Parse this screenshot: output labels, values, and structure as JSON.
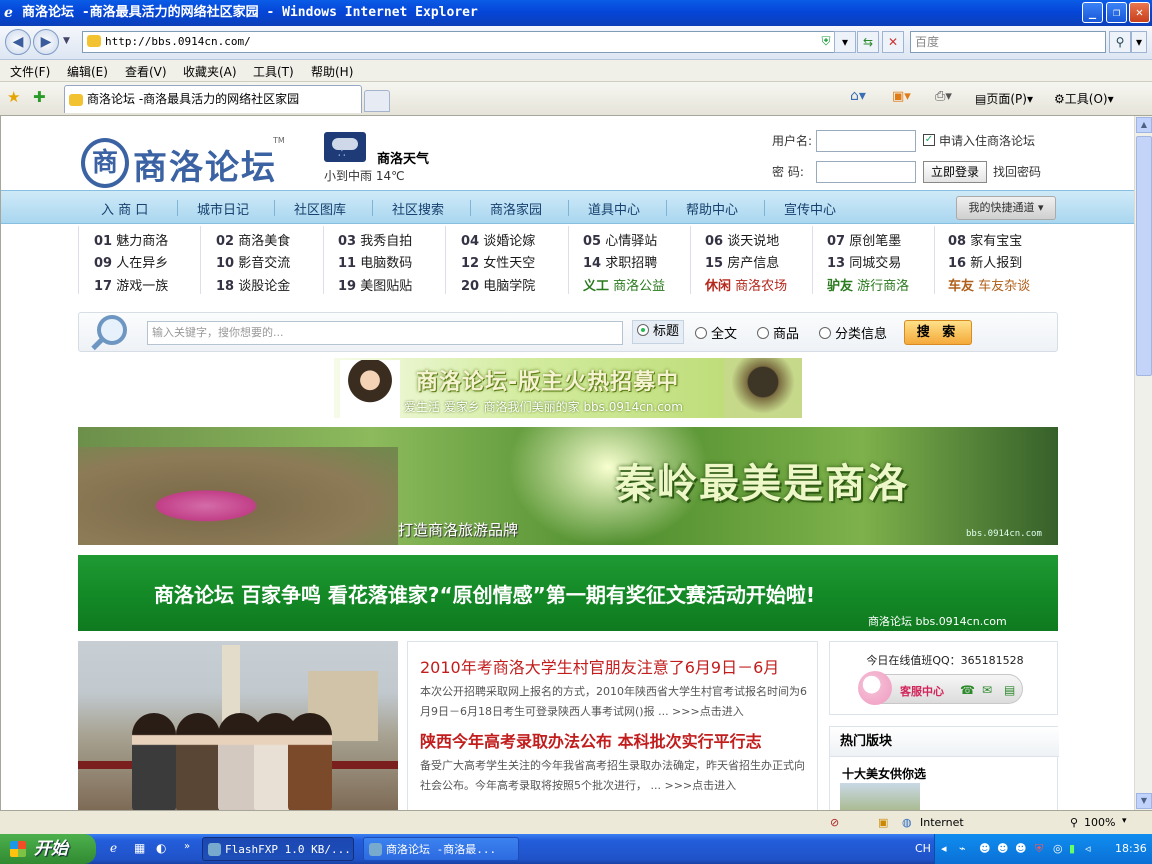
{
  "window": {
    "title": "商洛论坛 -商洛最具活力的网络社区家园 - Windows Internet Explorer",
    "min": "_",
    "max": "❐",
    "close": "✕"
  },
  "browser": {
    "url": "http://bbs.0914cn.com/",
    "search_placeholder": "百度",
    "menu": [
      "文件(F)",
      "编辑(E)",
      "查看(V)",
      "收藏夹(A)",
      "工具(T)",
      "帮助(H)"
    ],
    "tab_title": "商洛论坛 -商洛最具活力的网络社区家园",
    "toolbar": {
      "page": "页面(P)",
      "tools": "工具(O)"
    }
  },
  "site": {
    "logo_text": "商洛论坛",
    "logo_mark": "商",
    "logo_tm": "TM",
    "weather": {
      "name": "商洛天气",
      "desc": "小到中雨  14℃"
    },
    "login": {
      "user_label": "用户名:",
      "pass_label": "密  码:",
      "apply": "申请入住商洛论坛",
      "login_btn": "立即登录",
      "forgot": "找回密码"
    },
    "nav": [
      "入 商 口",
      "城市日记",
      "社区图库",
      "社区搜索",
      "商洛家园",
      "道具中心",
      "帮助中心",
      "宣传中心"
    ],
    "quick": "我的快捷通道",
    "cats": [
      [
        {
          "n": "01",
          "t": "魅力商洛"
        },
        {
          "n": "09",
          "t": "人在异乡"
        },
        {
          "n": "17",
          "t": "游戏一族"
        }
      ],
      [
        {
          "n": "02",
          "t": "商洛美食"
        },
        {
          "n": "10",
          "t": "影音交流"
        },
        {
          "n": "18",
          "t": "谈股论金"
        }
      ],
      [
        {
          "n": "03",
          "t": "我秀自拍"
        },
        {
          "n": "11",
          "t": "电脑数码"
        },
        {
          "n": "19",
          "t": "美图贴贴"
        }
      ],
      [
        {
          "n": "04",
          "t": "谈婚论嫁"
        },
        {
          "n": "12",
          "t": "女性天空"
        },
        {
          "n": "20",
          "t": "电脑学院"
        }
      ],
      [
        {
          "n": "05",
          "t": "心情驿站"
        },
        {
          "n": "14",
          "t": "求职招聘"
        },
        {
          "n": "义工",
          "t": "商洛公益"
        }
      ],
      [
        {
          "n": "06",
          "t": "谈天说地"
        },
        {
          "n": "15",
          "t": "房产信息"
        },
        {
          "n": "休闲",
          "t": "商洛农场"
        }
      ],
      [
        {
          "n": "07",
          "t": "原创笔墨"
        },
        {
          "n": "13",
          "t": "同城交易"
        },
        {
          "n": "驴友",
          "t": "游行商洛"
        }
      ],
      [
        {
          "n": "08",
          "t": "家有宝宝"
        },
        {
          "n": "16",
          "t": "新人报到"
        },
        {
          "n": "车友",
          "t": "车友杂谈"
        }
      ]
    ],
    "search": {
      "placeholder": "输入关键字，搜你想要的...",
      "opts": [
        "标题",
        "全文",
        "商品",
        "分类信息"
      ],
      "btn": "搜 索"
    },
    "banner1": {
      "title": "商洛论坛-版主火热招募中",
      "sub": "爱生活 爱家乡 商洛我们美丽的家 bbs.0914cn.com"
    },
    "banner2": {
      "big": "秦岭最美是商洛",
      "small": "打造商洛旅游品牌",
      "url": "bbs.0914cn.com"
    },
    "banner3": {
      "text": "商洛论坛 百家争鸣 看花落谁家?“原创情感”第一期有奖征文赛活动开始啦!",
      "url": "商洛论坛  bbs.0914cn.com"
    },
    "news": [
      {
        "title": "2010年考商洛大学生村官朋友注意了6月9日－6月",
        "body": "本次公开招聘采取网上报名的方式，2010年陕西省大学生村官考试报名时间为6月9日－6月18日考生可登录陕西人事考试网()报  ...  >>>点击进入"
      },
      {
        "title": "陕西今年高考录取办法公布 本科批次实行平行志",
        "body": "备受广大高考学生关注的今年我省高考招生录取办法确定，昨天省招生办正式向社会公布。今年高考录取将按照5个批次进行，  ...  >>>点击进入"
      }
    ],
    "online": "今日在线值班QQ：365181528",
    "kf": "客服中心",
    "hot_title": "热门版块",
    "hot_item": "十大美女供你选"
  },
  "statusbar": {
    "zone": "Internet",
    "zoom": "100%"
  },
  "taskbar": {
    "start": "开始",
    "tasks": [
      "FlashFXP 1.0 KB/...",
      "商洛论坛 -商洛最..."
    ],
    "ime": "CH",
    "clock": "18:36"
  }
}
